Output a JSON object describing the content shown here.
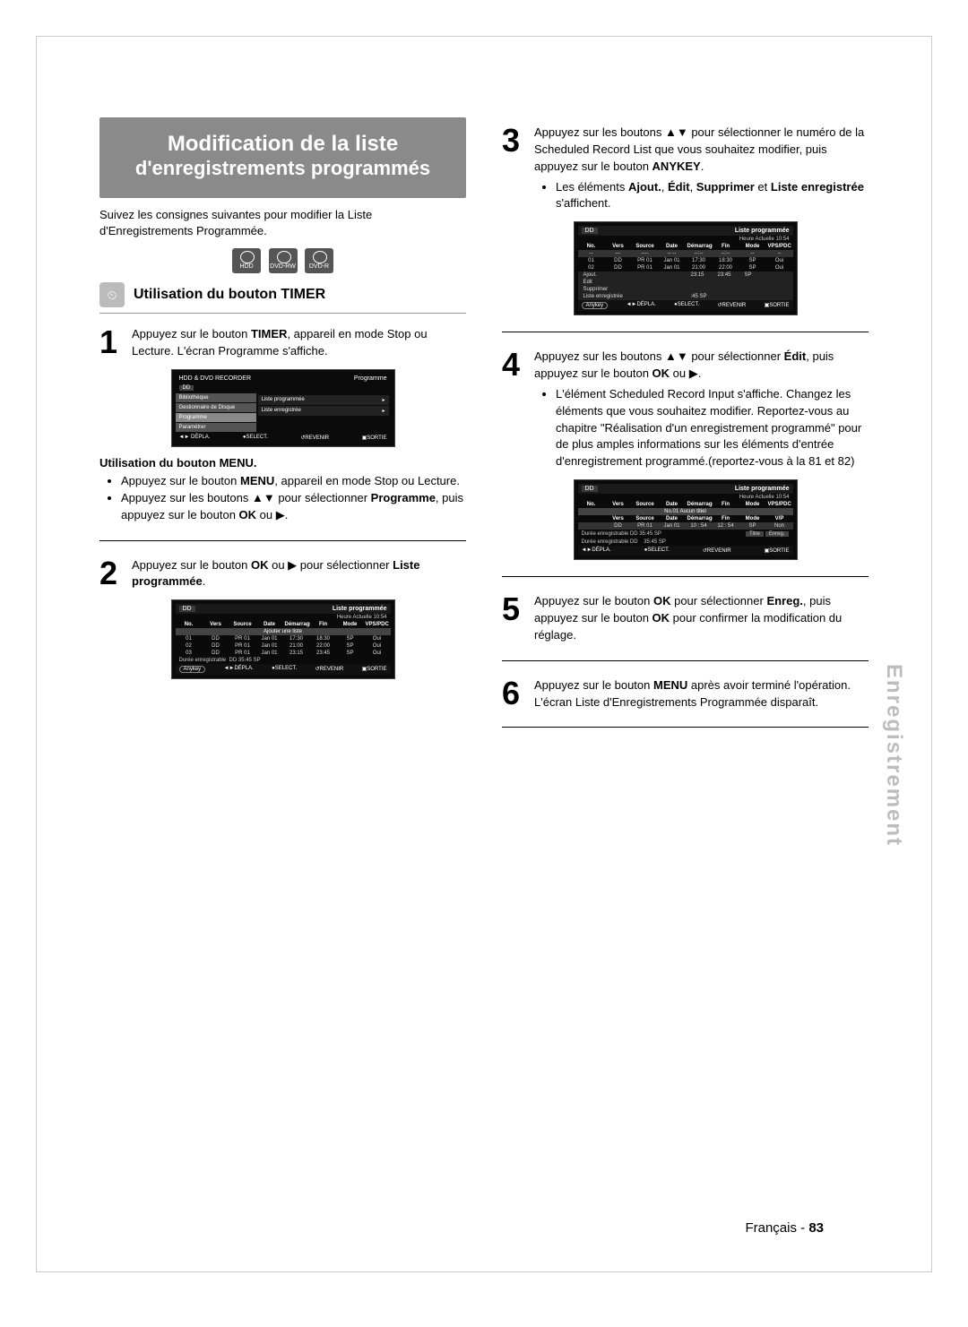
{
  "title": {
    "line1": "Modification de la liste",
    "line2": "d'enregistrements programmés"
  },
  "intro": "Suivez les consignes suivantes pour modifier la Liste d'Enregistrements Programmée.",
  "disc_icons": {
    "a": "HDD",
    "b": "DVD-RW",
    "c": "DVD-R"
  },
  "section_timer": "Utilisation du bouton TIMER",
  "step1": {
    "text_a": "Appuyez sur le bouton ",
    "bold_a": "TIMER",
    "text_b": ", appareil en mode Stop ou Lecture. L'écran Programme s'affiche."
  },
  "tv_menu": {
    "top_left": "HDD & DVD RECORDER",
    "top_right": "Programme",
    "dd": "DD",
    "side": {
      "bibliotheque": "Bibliothèque",
      "gestionnaire": "Gestionnaire de Disque",
      "programme": "Programme",
      "parametrer": "Paramétrer"
    },
    "pane": {
      "liste_prog": "Liste programmée",
      "liste_enr": "Liste enregistrée"
    },
    "foot": {
      "depla": "DÉPLA.",
      "select": "SELECT.",
      "revenir": "REVENIR",
      "sortie": "SORTIE"
    }
  },
  "subhead_menu": "Utilisation du bouton MENU.",
  "menu_bullets": {
    "b1a": "Appuyez sur le bouton ",
    "b1b": "MENU",
    "b1c": ", appareil en mode Stop ou Lecture.",
    "b2a": "Appuyez sur les boutons ▲▼ pour sélectionner ",
    "b2b": "Programme",
    "b2c": ", puis appuyez sur le bouton ",
    "b2d": "OK",
    "b2e": " ou ▶."
  },
  "step2": {
    "a": "Appuyez sur le bouton ",
    "b": "OK",
    "c": " ou ▶ pour sélectionner ",
    "d": "Liste programmée",
    "e": "."
  },
  "tv2": {
    "dd": "DD",
    "title": "Liste programmée",
    "sub": "Heure Actuelle 10:54",
    "headers": {
      "no": "No.",
      "vers": "Vers",
      "source": "Source",
      "date": "Date",
      "dem": "Démarrage",
      "fin": "Fin",
      "mode": "Mode",
      "vps": "VPS/PDC"
    },
    "mid": "Ajouter une liste",
    "rows": [
      {
        "no": "01",
        "vers": "DD",
        "source": "PR 01",
        "date": "Jan 01",
        "dem": "17:30",
        "fin": "18:30",
        "mode": "SP",
        "vps": "Oui"
      },
      {
        "no": "02",
        "vers": "DD",
        "source": "PR 01",
        "date": "Jan 01",
        "dem": "21:00",
        "fin": "22:00",
        "mode": "SP",
        "vps": "Oui"
      },
      {
        "no": "03",
        "vers": "DD",
        "source": "PR 01",
        "date": "Jan 01",
        "dem": "23:15",
        "fin": "23:45",
        "mode": "SP",
        "vps": "Oui"
      }
    ],
    "note_label": "Durée enregistrable",
    "note_val": "DD  35:45 SP",
    "anykey": "Anykey",
    "foot": {
      "depla": "DÉPLA.",
      "select": "SELECT.",
      "revenir": "REVENIR",
      "sortie": "SORTIE"
    }
  },
  "step3": {
    "a": "Appuyez sur les boutons ▲▼ pour sélectionner le numéro de la Scheduled Record List que vous souhaitez modifier, puis appuyez sur le bouton ",
    "b": "ANYKEY",
    "c": ".",
    "bullet_a": "Les éléments ",
    "bullet_b1": "Ajout.",
    "bullet_b2": ", ",
    "bullet_b3": "Édit",
    "bullet_b4": ", ",
    "bullet_b5": "Supprimer",
    "bullet_b6": " et ",
    "bullet_b7": "Liste enregistrée",
    "bullet_b8": " s'affichent."
  },
  "tv3": {
    "dd": "DD",
    "title": "Liste programmée",
    "sub": "Heure Actuelle 10:54",
    "headers": {
      "no": "No.",
      "vers": "Vers",
      "source": "Source",
      "date": "Date",
      "dem": "Démarrage",
      "fin": "Fin",
      "mode": "Mode",
      "vps": "VPS/PDC"
    },
    "dashrow": {
      "no": "--",
      "vers": "---",
      "source": "----",
      "date": "-- --",
      "dem": "--:--",
      "fin": "--:--",
      "mode": "--",
      "vps": "--"
    },
    "rows": [
      {
        "no": "01",
        "vers": "DD",
        "source": "PR 01",
        "date": "Jan 01",
        "dem": "17:30",
        "fin": "18:30",
        "mode": "SP",
        "vps": "Oui"
      },
      {
        "no": "02",
        "vers": "DD",
        "source": "PR 01",
        "date": "Jan 01",
        "dem": "21:00",
        "fin": "22:00",
        "mode": "SP",
        "vps": "Oui"
      }
    ],
    "ctx": {
      "ajout": "Ajout.",
      "edit": "Édit",
      "supp": "Supprimer",
      "liste": "Liste enregistrée"
    },
    "ctx_row_tail": {
      "dem": "23:15",
      "fin": "23:45",
      "mode": "SP"
    },
    "ctx_row_liste_tail": ":45 SP",
    "anykey": "Anykey",
    "foot": {
      "depla": "DÉPLA.",
      "select": "SELECT.",
      "revenir": "REVENIR",
      "sortie": "SORTIE"
    }
  },
  "step4": {
    "a": "Appuyez sur les boutons ▲▼ pour sélectionner ",
    "b": "Édit",
    "c": ", puis appuyez sur le bouton ",
    "d": "OK",
    "e": " ou ▶.",
    "bullet": "L'élément Scheduled Record Input s'affiche. Changez les éléments que vous souhaitez modifier. Reportez-vous au chapitre \"Réalisation d'un enregistrement programmé\" pour de plus amples informations sur les éléments d'entrée d'enregistrement programmé.(reportez-vous à la 81 et 82)"
  },
  "tv4": {
    "dd": "DD",
    "title": "Liste programmée",
    "sub": "Heure Actuelle 10:54",
    "headers": {
      "no": "No.",
      "vers": "Vers",
      "source": "Source",
      "date": "Date",
      "dem": "Démarrage",
      "fin": "Fin",
      "mode": "Mode",
      "vps": "VPS/PDC"
    },
    "mid": "No.01 Aucun titiel",
    "h2": {
      "vers": "Vers",
      "source": "Source",
      "date": "Date",
      "dem": "Démarrage",
      "fin": "Fin",
      "mode": "Mode",
      "vp": "V/P"
    },
    "row": {
      "vers": "DD",
      "source": "PR 01",
      "date": "Jan 01",
      "dem": "10 : 54",
      "fin": "12 : 54",
      "mode": "SP",
      "vp": "Non"
    },
    "note1_label": "Durée enregistrable",
    "note1_a": "DD",
    "note1_b": "35:45 SP",
    "btn_titre": "Titre",
    "btn_enreg": "Enreg.",
    "note2_label": "Durée enregistrable",
    "note2_a": "DD",
    "note2_b": "35:45  SP",
    "foot": {
      "depla": "DÉPLA.",
      "select": "SELECT.",
      "revenir": "REVENIR",
      "sortie": "SORTIE"
    }
  },
  "step5": {
    "a": "Appuyez sur le bouton ",
    "b": "OK",
    "c": " pour sélectionner ",
    "d": "Enreg.",
    "e": ", puis appuyez sur le bouton ",
    "f": "OK",
    "g": " pour confirmer la modification du réglage."
  },
  "step6": {
    "a": "Appuyez sur le bouton ",
    "b": "MENU",
    "c": " après avoir terminé l'opération.",
    "d": "L'écran Liste d'Enregistrements Programmée disparaît."
  },
  "sidetab": "Enregistrement",
  "footer": {
    "lang": "Français",
    "dash": " - ",
    "page": "83"
  },
  "nums": {
    "n1": "1",
    "n2": "2",
    "n3": "3",
    "n4": "4",
    "n5": "5",
    "n6": "6"
  },
  "glyphs": {
    "timer": "⏲",
    "arrow": "▸",
    "dot": "●"
  }
}
